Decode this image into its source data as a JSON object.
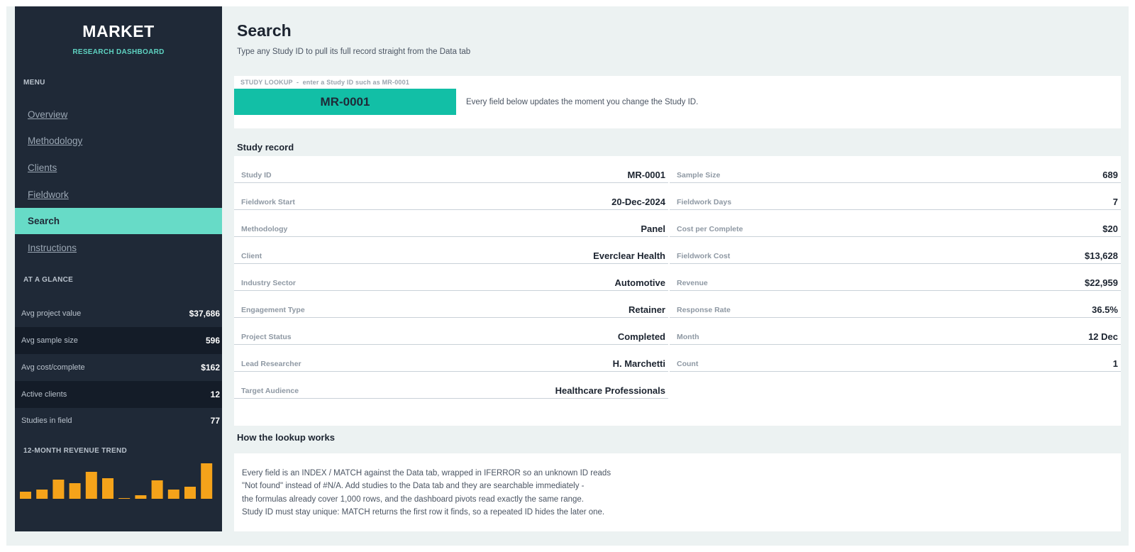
{
  "sidebar": {
    "brand_title": "MARKET",
    "brand_subtitle": "RESEARCH DASHBOARD",
    "menu_label": "MENU",
    "menu_items": [
      {
        "label": "Overview",
        "active": false
      },
      {
        "label": "Methodology",
        "active": false
      },
      {
        "label": "Clients",
        "active": false
      },
      {
        "label": "Fieldwork",
        "active": false
      },
      {
        "label": "Search",
        "active": true
      },
      {
        "label": "Instructions",
        "active": false
      }
    ],
    "glance_label": "AT A GLANCE",
    "glance": [
      {
        "label": "Avg project value",
        "value": "$37,686"
      },
      {
        "label": "Avg sample size",
        "value": "596"
      },
      {
        "label": "Avg cost/complete",
        "value": "$162"
      },
      {
        "label": "Active clients",
        "value": "12"
      },
      {
        "label": "Studies in field",
        "value": "77"
      }
    ],
    "trend_label": "12-MONTH REVENUE TREND"
  },
  "chart_data": {
    "type": "bar",
    "title": "12-MONTH REVENUE TREND",
    "values": [
      10,
      13,
      27,
      22,
      38,
      29,
      1,
      5,
      26,
      13,
      17,
      50
    ],
    "ylim": [
      0,
      52
    ],
    "grid": false,
    "bar_color": "#f5a31a"
  },
  "main": {
    "title": "Search",
    "subtitle": "Type any Study ID to pull its full record straight from the Data tab",
    "lookup": {
      "label": "STUDY LOOKUP  -  enter a Study ID such as MR-0001",
      "value": "MR-0001",
      "hint": "Every field below updates the moment you change the Study ID."
    },
    "record_title": "Study record",
    "record_left": [
      {
        "label": "Study ID",
        "value": "MR-0001"
      },
      {
        "label": "Fieldwork Start",
        "value": "20-Dec-2024"
      },
      {
        "label": "Methodology",
        "value": "Panel"
      },
      {
        "label": "Client",
        "value": "Everclear Health"
      },
      {
        "label": "Industry Sector",
        "value": "Automotive"
      },
      {
        "label": "Engagement Type",
        "value": "Retainer"
      },
      {
        "label": "Project Status",
        "value": "Completed"
      },
      {
        "label": "Lead Researcher",
        "value": "H. Marchetti"
      },
      {
        "label": "Target Audience",
        "value": "Healthcare Professionals"
      }
    ],
    "record_right": [
      {
        "label": "Sample Size",
        "value": "689"
      },
      {
        "label": "Fieldwork Days",
        "value": "7"
      },
      {
        "label": "Cost per Complete",
        "value": "$20"
      },
      {
        "label": "Fieldwork Cost",
        "value": "$13,628"
      },
      {
        "label": "Revenue",
        "value": "$22,959"
      },
      {
        "label": "Response Rate",
        "value": "36.5%"
      },
      {
        "label": "Month",
        "value": "12 Dec"
      },
      {
        "label": "Count",
        "value": "1"
      }
    ],
    "how_title": "How the lookup works",
    "how_lines": [
      "Every field is an INDEX / MATCH against the Data tab, wrapped in IFERROR so an unknown ID reads",
      "\"Not found\" instead of #N/A. Add studies to the Data tab and they are searchable immediately -",
      "the formulas already cover 1,000 rows, and the dashboard pivots read exactly the same range.",
      "Study ID must stay unique: MATCH returns the first row it finds, so a repeated ID hides the later one."
    ]
  },
  "colors": {
    "sidebar_bg": "#1f2937",
    "accent_teal": "#12bfa6",
    "active_menu": "#67dbc7",
    "bar_orange": "#f5a31a"
  }
}
